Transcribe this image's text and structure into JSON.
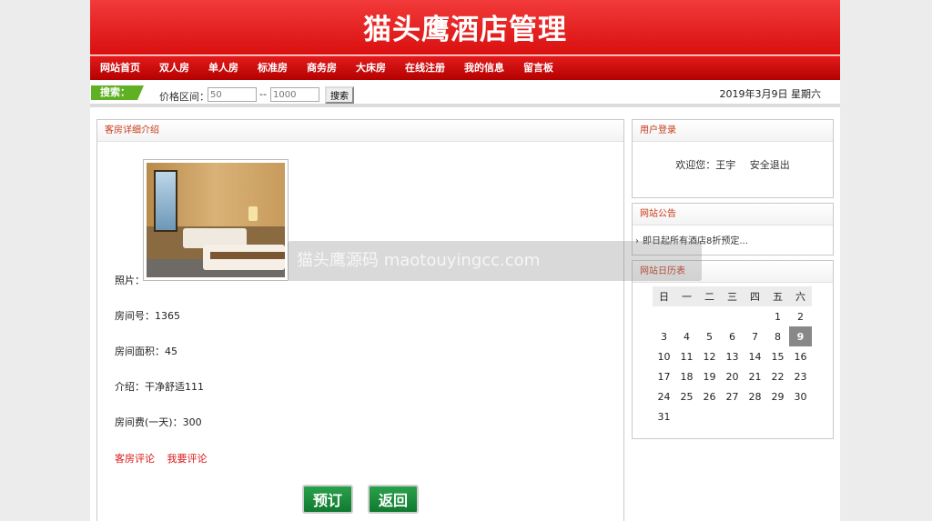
{
  "header": {
    "title": "猫头鹰酒店管理"
  },
  "nav": [
    "网站首页",
    "双人房",
    "单人房",
    "标准房",
    "商务房",
    "大床房",
    "在线注册",
    "我的信息",
    "留言板"
  ],
  "search": {
    "tag": "搜索：",
    "price_label": "价格区间：",
    "min_placeholder": "50",
    "max_placeholder": "1000",
    "dash": "--",
    "button": "搜索",
    "date": "2019年3月9日 星期六"
  },
  "detail": {
    "title": "客房详细介绍",
    "photo_label": "照片：",
    "room_no": "房间号：1365",
    "area": "房间面积：45",
    "intro": "介绍：干净舒适111",
    "price": "房间费(一天)：300",
    "comments_link": "客房评论",
    "write_comment_link": "我要评论",
    "book_button": "预订",
    "back_button": "返回"
  },
  "login": {
    "title": "用户登录",
    "welcome": "欢迎您：王宇",
    "logout": "安全退出"
  },
  "notice": {
    "title": "网站公告",
    "item": "即日起所有酒店8折预定..."
  },
  "calendar": {
    "title": "网站日历表",
    "weekdays": [
      "日",
      "一",
      "二",
      "三",
      "四",
      "五",
      "六"
    ],
    "today": "9",
    "weeks": [
      [
        "",
        "",
        "",
        "",
        "",
        "1",
        "2"
      ],
      [
        "3",
        "4",
        "5",
        "6",
        "7",
        "8",
        "9"
      ],
      [
        "10",
        "11",
        "12",
        "13",
        "14",
        "15",
        "16"
      ],
      [
        "17",
        "18",
        "19",
        "20",
        "21",
        "22",
        "23"
      ],
      [
        "24",
        "25",
        "26",
        "27",
        "28",
        "29",
        "30"
      ],
      [
        "31",
        "",
        "",
        "",
        "",
        "",
        ""
      ]
    ]
  },
  "watermark": "猫头鹰源码 maotouyingcc.com"
}
